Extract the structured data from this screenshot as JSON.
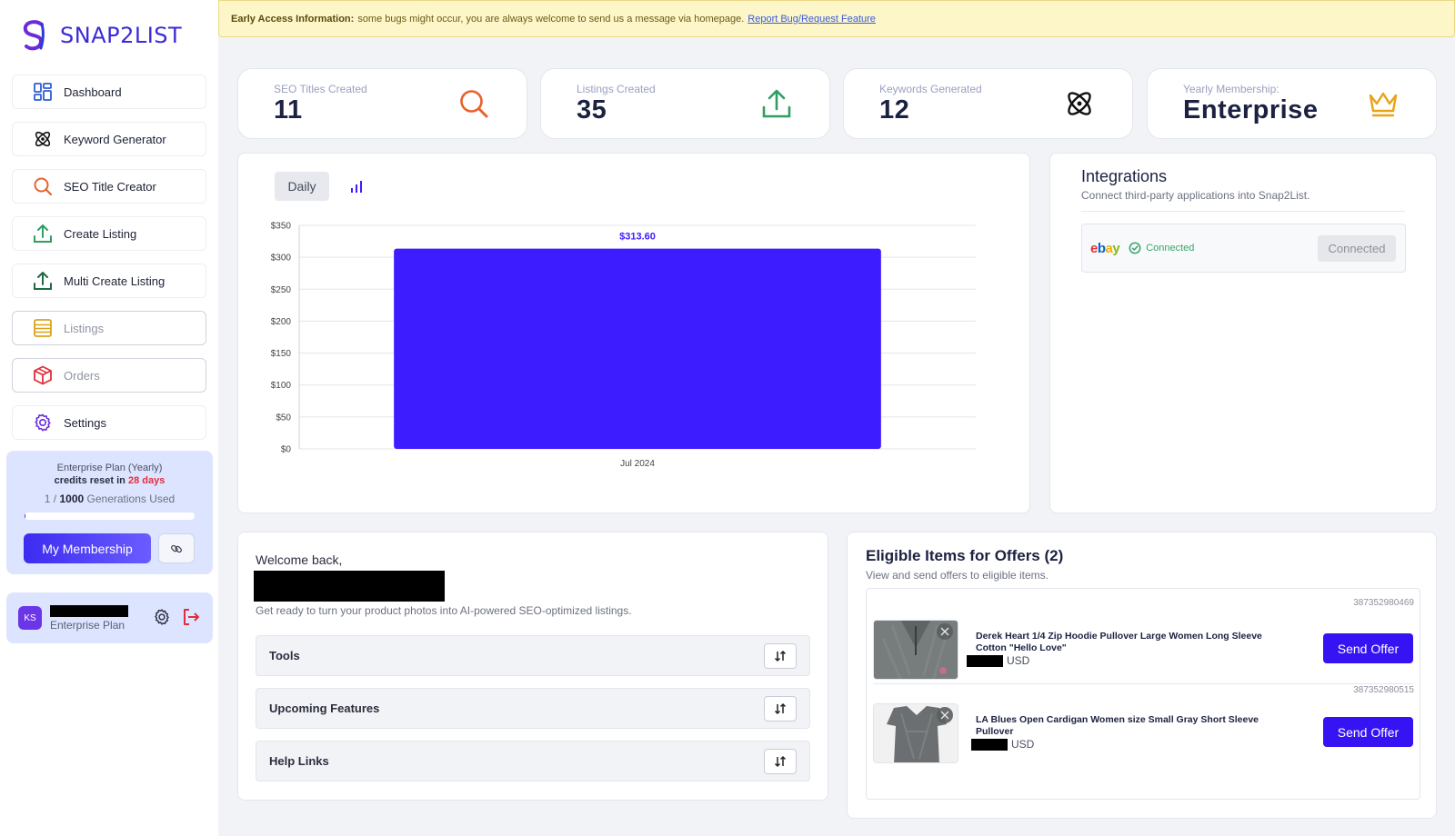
{
  "app": {
    "name": "SNAP2LIST"
  },
  "banner": {
    "label": "Early Access Information:",
    "message": "some bugs might occur, you are always welcome to send us a message via homepage.",
    "link": "Report Bug/Request Feature"
  },
  "sidebar": {
    "items": [
      {
        "label": "Dashboard",
        "icon": "dashboard-grid-icon"
      },
      {
        "label": "Keyword Generator",
        "icon": "atom-icon"
      },
      {
        "label": "SEO Title Creator",
        "icon": "search-icon"
      },
      {
        "label": "Create Listing",
        "icon": "upload-icon"
      },
      {
        "label": "Multi Create Listing",
        "icon": "upload-icon"
      },
      {
        "label": "Listings",
        "icon": "list-icon"
      },
      {
        "label": "Orders",
        "icon": "box-icon"
      },
      {
        "label": "Settings",
        "icon": "gear-icon"
      }
    ],
    "plan": {
      "name": "Enterprise Plan (Yearly)",
      "reset_prefix": "credits reset in",
      "reset_days": "28 days",
      "used": "1",
      "separator": " / ",
      "total": "1000",
      "used_suffix": " Generations Used",
      "usage_fraction": 0.001,
      "membership_button": "My Membership"
    },
    "user": {
      "initials": "KS",
      "plan": "Enterprise Plan"
    }
  },
  "stats": [
    {
      "label": "SEO Titles Created",
      "value": "11",
      "icon": "search-icon",
      "color": "#e8622c"
    },
    {
      "label": "Listings Created",
      "value": "35",
      "icon": "upload-icon",
      "color": "#2e9e63"
    },
    {
      "label": "Keywords Generated",
      "value": "12",
      "icon": "atom-icon",
      "color": "#111111"
    },
    {
      "label": "Yearly Membership:",
      "value": "Enterprise",
      "icon": "crown-icon",
      "color": "#e9a318"
    }
  ],
  "chart_controls": {
    "active": "Daily"
  },
  "chart_data": {
    "type": "bar",
    "categories": [
      "Jul 2024"
    ],
    "values": [
      313.6
    ],
    "value_labels": [
      "$313.60"
    ],
    "ylim": [
      0,
      350
    ],
    "yticks": [
      0,
      50,
      100,
      150,
      200,
      250,
      300,
      350
    ],
    "ytick_labels": [
      "$0",
      "$50",
      "$100",
      "$150",
      "$200",
      "$250",
      "$300",
      "$350"
    ],
    "grid": true,
    "bar_color": "#3d1cff",
    "label_color": "#3d1cff"
  },
  "integrations": {
    "title": "Integrations",
    "subtitle": "Connect third-party applications into Snap2List.",
    "items": [
      {
        "name": "ebay",
        "status": "Connected",
        "button": "Connected"
      }
    ]
  },
  "welcome": {
    "title": "Welcome back,",
    "subtitle": "Get ready to turn your product photos into AI-powered SEO-optimized listings.",
    "sections": [
      "Tools",
      "Upcoming Features",
      "Help Links"
    ]
  },
  "offers": {
    "title": "Eligible Items for Offers (2)",
    "subtitle": "View and send offers to eligible items.",
    "items": [
      {
        "sku": "387352980469",
        "name": "Derek Heart 1/4 Zip Hoodie Pullover Large Women Long Sleeve Cotton \"Hello Love\"",
        "currency": "USD",
        "button": "Send Offer"
      },
      {
        "sku": "387352980515",
        "name": "LA Blues Open Cardigan Women size Small Gray Short Sleeve Pullover",
        "currency": "USD",
        "button": "Send Offer"
      }
    ]
  }
}
